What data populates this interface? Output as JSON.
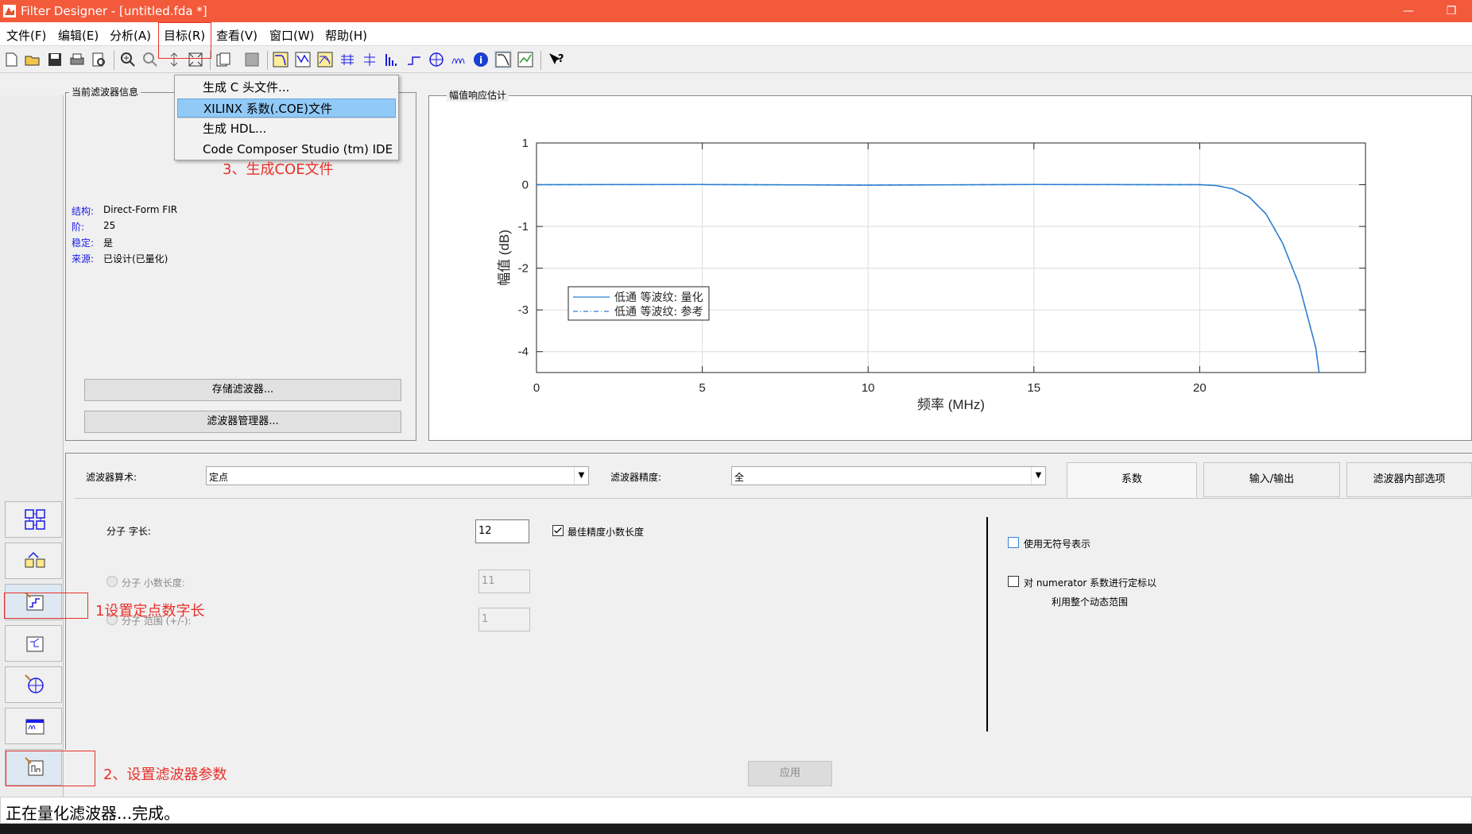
{
  "window": {
    "title": "Filter Designer -  [untitled.fda *]",
    "minimize": "—",
    "restore": "❐"
  },
  "menu": [
    "文件(F)",
    "编辑(E)",
    "分析(A)",
    "目标(R)",
    "查看(V)",
    "窗口(W)",
    "帮助(H)"
  ],
  "target_menu": {
    "items": [
      "生成 C 头文件...",
      "XILINX 系数(.COE)文件",
      "生成 HDL...",
      "Code Composer Studio (tm) IDE"
    ]
  },
  "info_panel": {
    "title": "当前滤波器信息",
    "rows": [
      {
        "label": "结构:",
        "value": "Direct-Form FIR"
      },
      {
        "label": "阶:",
        "value": "25"
      },
      {
        "label": "稳定:",
        "value": "是"
      },
      {
        "label": "来源:",
        "value": "已设计(已量化)"
      }
    ],
    "store_button": "存储滤波器...",
    "manager_button": "滤波器管理器..."
  },
  "plot_panel": {
    "title": "幅值响应估计"
  },
  "chart_data": {
    "type": "line",
    "xlabel": "频率 (MHz)",
    "ylabel": "幅值 (dB)",
    "xlim": [
      0,
      25
    ],
    "ylim": [
      -4.5,
      1
    ],
    "xticks": [
      0,
      5,
      10,
      15,
      20
    ],
    "yticks": [
      1,
      0,
      -1,
      -2,
      -3,
      -4
    ],
    "grid": true,
    "legend_position": "lower-left",
    "series": [
      {
        "name": "低通 等波纹: 量化",
        "style": "solid",
        "color": "#2a7ed0",
        "x": [
          0,
          5,
          10,
          15,
          19,
          20,
          20.5,
          21,
          21.5,
          22,
          22.5,
          23,
          23.5,
          23.6
        ],
        "y": [
          0,
          0.005,
          -0.01,
          0.005,
          0,
          0,
          -0.02,
          -0.1,
          -0.3,
          -0.7,
          -1.4,
          -2.4,
          -3.9,
          -4.5
        ]
      },
      {
        "name": "低通 等波纹: 参考",
        "style": "dashdot",
        "color": "#2a7ed0",
        "x": [
          0,
          5,
          10,
          15,
          19,
          20,
          20.5,
          21,
          21.5,
          22,
          22.5,
          23,
          23.5,
          23.6
        ],
        "y": [
          0,
          0.005,
          -0.01,
          0.005,
          0,
          0,
          -0.02,
          -0.1,
          -0.3,
          -0.7,
          -1.4,
          -2.4,
          -3.9,
          -4.5
        ]
      }
    ]
  },
  "quant": {
    "arith_label": "滤波器算术:",
    "arith_value": "定点",
    "precision_label": "滤波器精度:",
    "precision_value": "全",
    "tabs": [
      "系数",
      "输入/输出",
      "滤波器内部选项"
    ],
    "numerator_wordlength_label": "分子 字长:",
    "numerator_wordlength_value": "12",
    "best_precision_label": "最佳精度小数长度",
    "frac_length_label": "分子 小数长度:",
    "frac_length_value": "11",
    "range_label": "分子 范围 (+/-):",
    "range_value": "1",
    "unsigned_label": "使用无符号表示",
    "scale_label_1": "对 numerator 系数进行定标以",
    "scale_label_2": "利用整个动态范围",
    "apply_button": "应用"
  },
  "annotations": {
    "a1": "1设置定点数字长",
    "a2": "2、设置滤波器参数",
    "a3": "3、生成COE文件"
  },
  "status": {
    "text": "正在量化滤波器...完成。"
  }
}
